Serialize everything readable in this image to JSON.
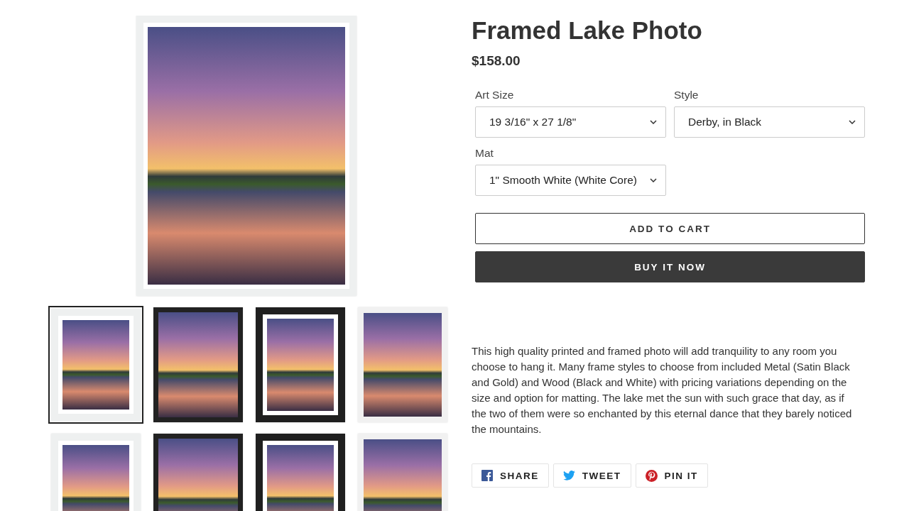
{
  "gallery": {
    "main_image": {
      "kind": "white-mat"
    },
    "thumbnails": [
      {
        "kind": "white-mat",
        "selected": true
      },
      {
        "kind": "black",
        "selected": false
      },
      {
        "kind": "black-mat",
        "selected": false
      },
      {
        "kind": "white",
        "selected": false
      },
      {
        "kind": "white-mat",
        "selected": false
      },
      {
        "kind": "black",
        "selected": false
      },
      {
        "kind": "black-mat",
        "selected": false
      },
      {
        "kind": "white",
        "selected": false
      }
    ]
  },
  "product": {
    "title": "Framed Lake Photo",
    "price": "$158.00",
    "options": [
      {
        "label": "Art Size",
        "value": "19 3/16\" x 27 1/8\""
      },
      {
        "label": "Style",
        "value": "Derby, in Black"
      },
      {
        "label": "Mat",
        "value": "1\" Smooth White (White Core)"
      }
    ],
    "buttons": [
      {
        "kind": "outline",
        "label": "ADD TO CART"
      },
      {
        "kind": "solid",
        "label": "BUY IT NOW"
      }
    ],
    "description": "This high quality printed and framed photo will add tranquility to any room you choose to hang it. Many frame styles to choose from included Metal (Satin Black and Gold) and Wood (Black and White) with pricing variations depending on the size and option for matting. The lake met the sun with such grace that day, as if the two of them were so enchanted by this eternal dance that they barely noticed the mountains.",
    "share": [
      {
        "kind": "facebook",
        "label": "SHARE"
      },
      {
        "kind": "twitter",
        "label": "TWEET"
      },
      {
        "kind": "pinterest",
        "label": "PIN IT"
      }
    ]
  }
}
